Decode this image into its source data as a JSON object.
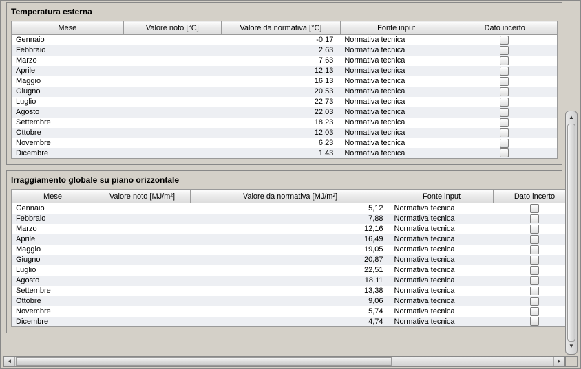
{
  "sections": {
    "temperature": {
      "title": "Temperatura esterna",
      "headers": {
        "month": "Mese",
        "known": "Valore noto [°C]",
        "norm": "Valore da normativa [°C]",
        "source": "Fonte input",
        "uncertain": "Dato incerto"
      },
      "rows": [
        {
          "month": "Gennaio",
          "known": "",
          "norm": "-0,17",
          "source": "Normativa tecnica",
          "uncertain": false
        },
        {
          "month": "Febbraio",
          "known": "",
          "norm": "2,63",
          "source": "Normativa tecnica",
          "uncertain": false
        },
        {
          "month": "Marzo",
          "known": "",
          "norm": "7,63",
          "source": "Normativa tecnica",
          "uncertain": false
        },
        {
          "month": "Aprile",
          "known": "",
          "norm": "12,13",
          "source": "Normativa tecnica",
          "uncertain": false
        },
        {
          "month": "Maggio",
          "known": "",
          "norm": "16,13",
          "source": "Normativa tecnica",
          "uncertain": false
        },
        {
          "month": "Giugno",
          "known": "",
          "norm": "20,53",
          "source": "Normativa tecnica",
          "uncertain": false
        },
        {
          "month": "Luglio",
          "known": "",
          "norm": "22,73",
          "source": "Normativa tecnica",
          "uncertain": false
        },
        {
          "month": "Agosto",
          "known": "",
          "norm": "22,03",
          "source": "Normativa tecnica",
          "uncertain": false
        },
        {
          "month": "Settembre",
          "known": "",
          "norm": "18,23",
          "source": "Normativa tecnica",
          "uncertain": false
        },
        {
          "month": "Ottobre",
          "known": "",
          "norm": "12,03",
          "source": "Normativa tecnica",
          "uncertain": false
        },
        {
          "month": "Novembre",
          "known": "",
          "norm": "6,23",
          "source": "Normativa tecnica",
          "uncertain": false
        },
        {
          "month": "Dicembre",
          "known": "",
          "norm": "1,43",
          "source": "Normativa tecnica",
          "uncertain": false
        }
      ]
    },
    "irradiation": {
      "title": "Irraggiamento globale su piano orizzontale",
      "headers": {
        "month": "Mese",
        "known": "Valore noto [MJ/m²]",
        "norm": "Valore da normativa [MJ/m²]",
        "source": "Fonte input",
        "uncertain": "Dato incerto"
      },
      "rows": [
        {
          "month": "Gennaio",
          "known": "",
          "norm": "5,12",
          "source": "Normativa tecnica",
          "uncertain": false
        },
        {
          "month": "Febbraio",
          "known": "",
          "norm": "7,88",
          "source": "Normativa tecnica",
          "uncertain": false
        },
        {
          "month": "Marzo",
          "known": "",
          "norm": "12,16",
          "source": "Normativa tecnica",
          "uncertain": false
        },
        {
          "month": "Aprile",
          "known": "",
          "norm": "16,49",
          "source": "Normativa tecnica",
          "uncertain": false
        },
        {
          "month": "Maggio",
          "known": "",
          "norm": "19,05",
          "source": "Normativa tecnica",
          "uncertain": false
        },
        {
          "month": "Giugno",
          "known": "",
          "norm": "20,87",
          "source": "Normativa tecnica",
          "uncertain": false
        },
        {
          "month": "Luglio",
          "known": "",
          "norm": "22,51",
          "source": "Normativa tecnica",
          "uncertain": false
        },
        {
          "month": "Agosto",
          "known": "",
          "norm": "18,11",
          "source": "Normativa tecnica",
          "uncertain": false
        },
        {
          "month": "Settembre",
          "known": "",
          "norm": "13,38",
          "source": "Normativa tecnica",
          "uncertain": false
        },
        {
          "month": "Ottobre",
          "known": "",
          "norm": "9,06",
          "source": "Normativa tecnica",
          "uncertain": false
        },
        {
          "month": "Novembre",
          "known": "",
          "norm": "5,74",
          "source": "Normativa tecnica",
          "uncertain": false
        },
        {
          "month": "Dicembre",
          "known": "",
          "norm": "4,74",
          "source": "Normativa tecnica",
          "uncertain": false
        }
      ]
    }
  }
}
